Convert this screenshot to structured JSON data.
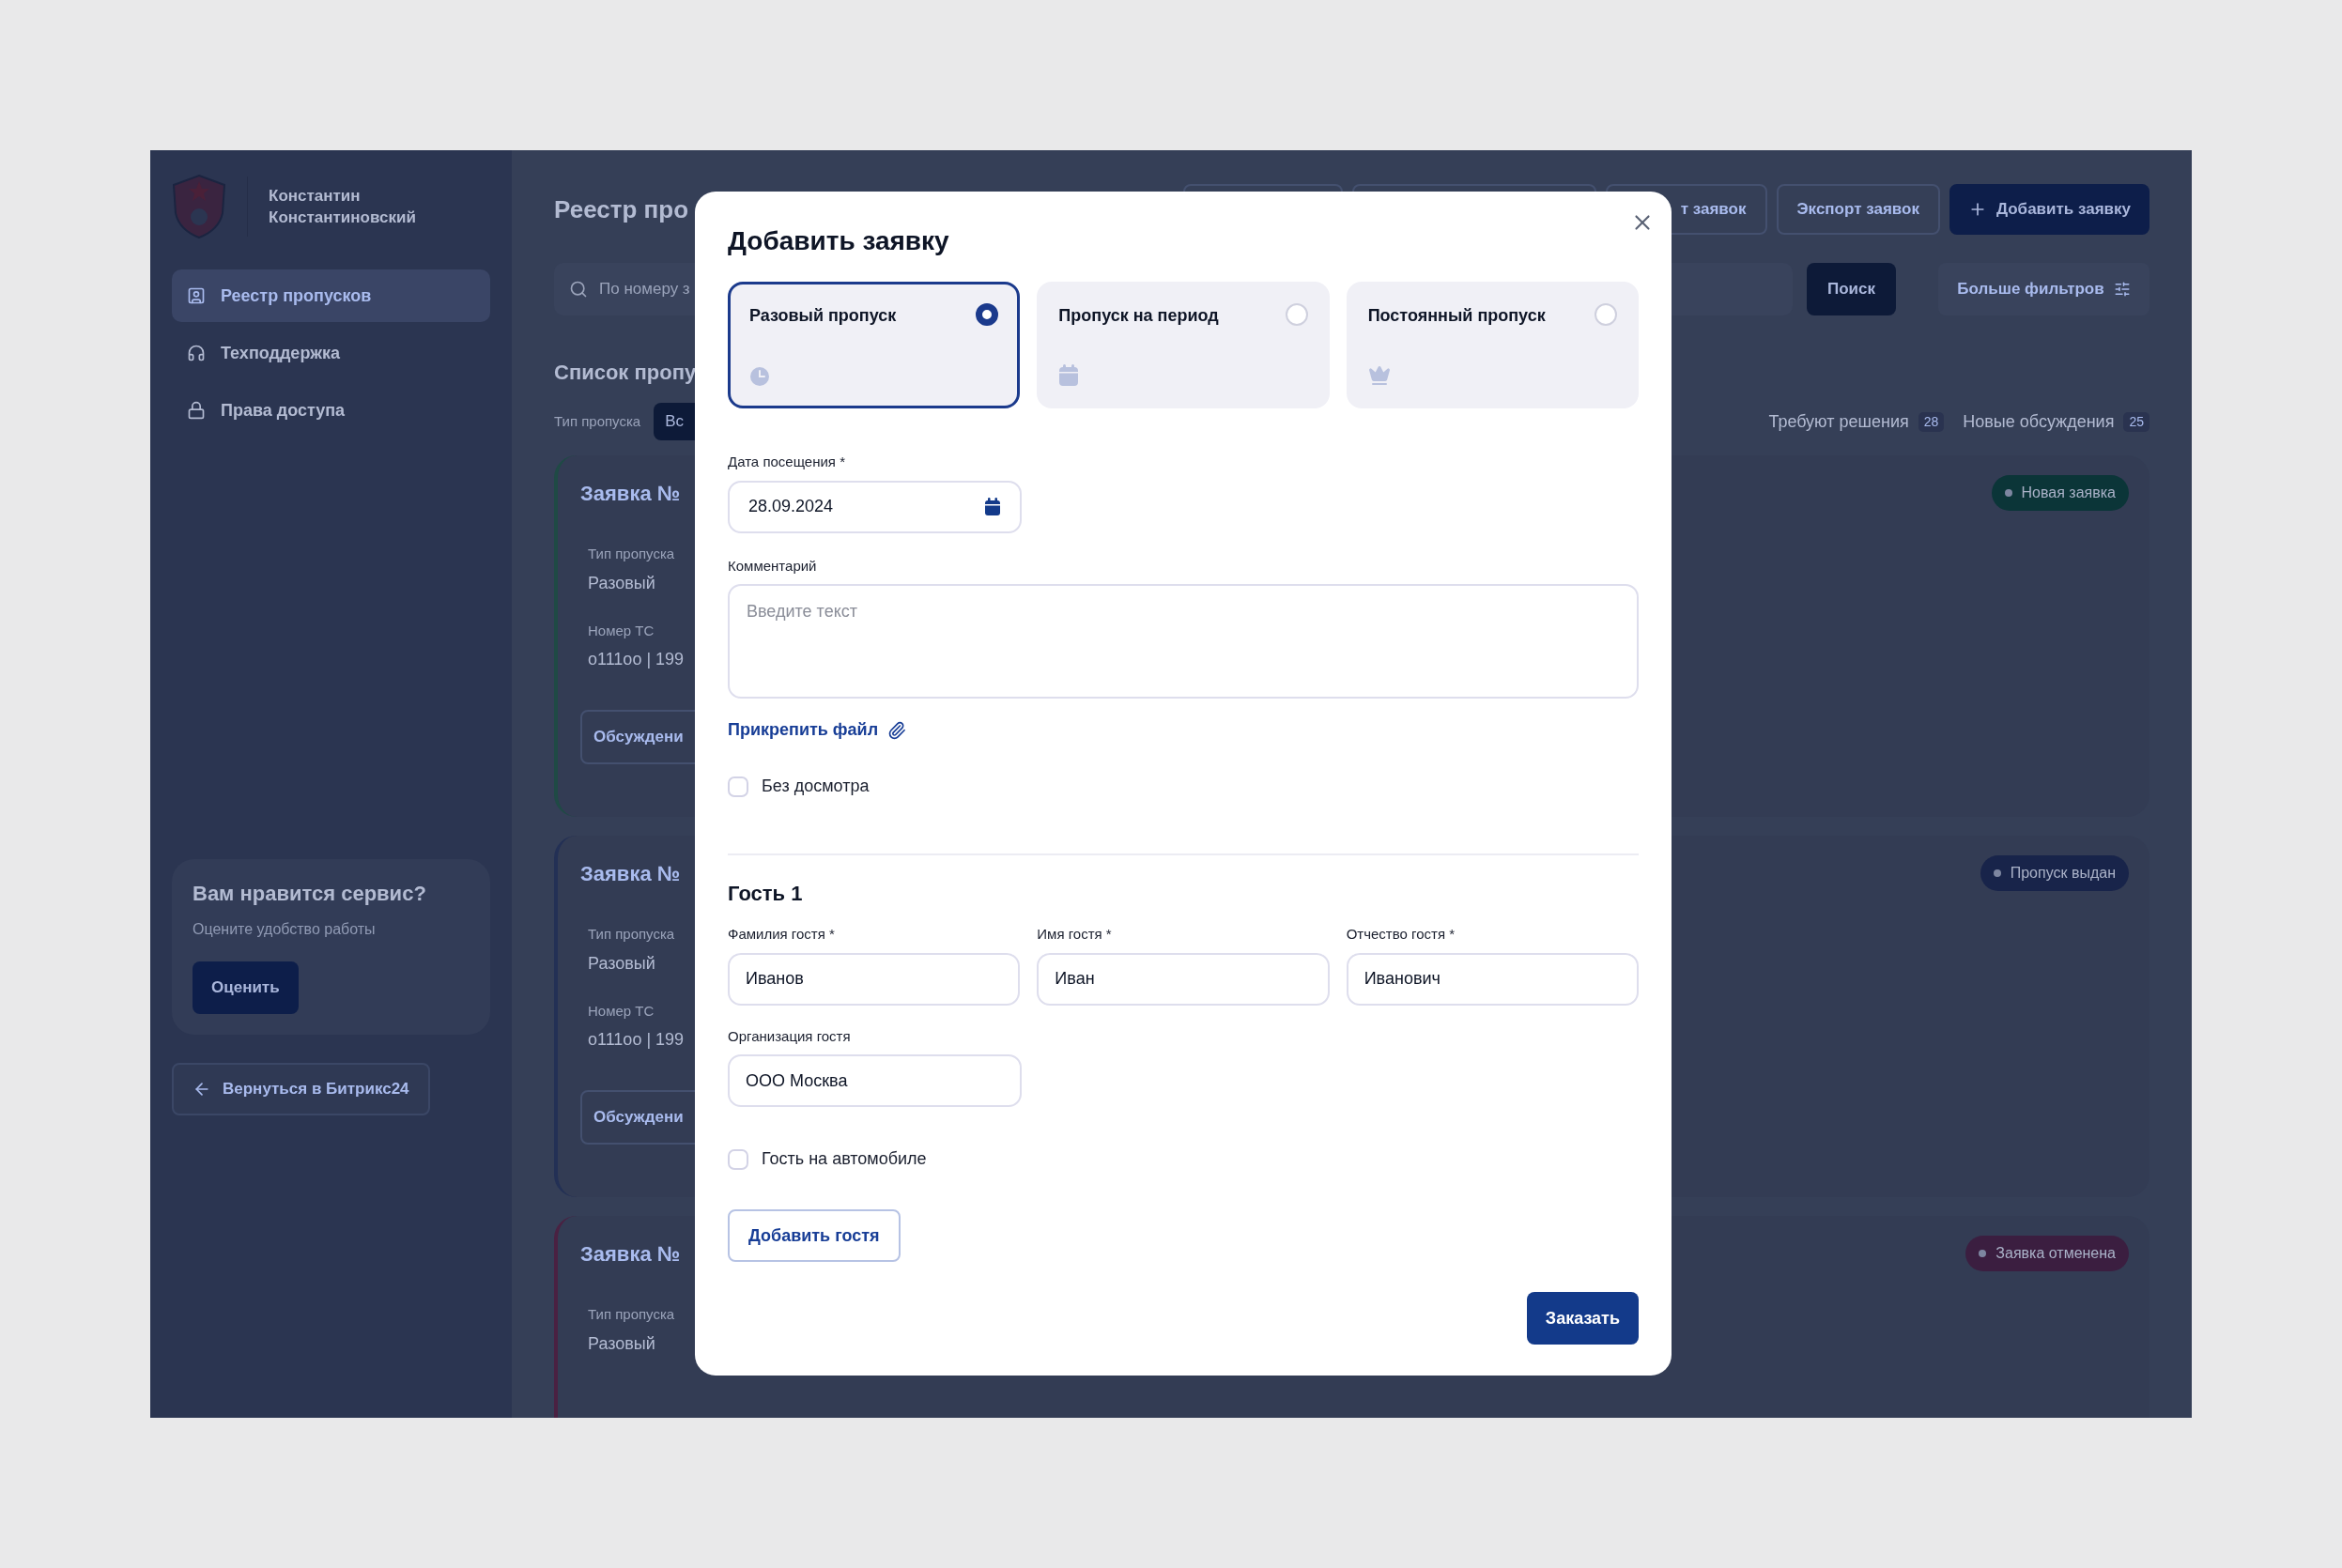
{
  "sidebar": {
    "user_name": "Константин Константиновский",
    "nav": [
      {
        "label": "Реестр пропусков",
        "selected": true
      },
      {
        "label": "Техподдержка",
        "selected": false
      },
      {
        "label": "Права доступа",
        "selected": false
      }
    ],
    "promo": {
      "title": "Вам нравится сервис?",
      "subtitle": "Оцените удобство работы",
      "button": "Оценить"
    },
    "back_button": "Вернуться в Битрикс24"
  },
  "main": {
    "title": "Реестр про",
    "toolbar": [
      {
        "label": "т заявок",
        "kind": "outline"
      },
      {
        "label": "Экспорт заявок",
        "kind": "outline"
      },
      {
        "label": "Добавить заявку",
        "kind": "primary"
      }
    ],
    "search": {
      "placeholder": "По номеру з",
      "button": "Поиск"
    },
    "more_filters": "Больше фильтров",
    "list_title": "Список пропу",
    "filter_label": "Тип пропуска",
    "filter_chip": "Вс",
    "counters": [
      {
        "label": "Требуют решения",
        "count": "28"
      },
      {
        "label": "Новые обсуждения",
        "count": "25"
      }
    ],
    "cards": [
      {
        "title": "Заявка №",
        "color": "#1f4a45",
        "fields": [
          {
            "label": "Тип пропуска",
            "value": "Разовый"
          },
          {
            "label": "Номер ТС",
            "value": "о111оо | 199"
          }
        ],
        "button": "Обсуждени",
        "status": {
          "label": "Новая заявка",
          "color": "#0b3538"
        }
      },
      {
        "title": "Заявка №",
        "color": "#233055",
        "fields": [
          {
            "label": "Тип пропуска",
            "value": "Разовый"
          },
          {
            "label": "Номер ТС",
            "value": "о111оо | 199"
          }
        ],
        "button": "Обсуждени",
        "status": {
          "label": "Пропуск выдан",
          "color": "#18244a"
        }
      },
      {
        "title": "Заявка №",
        "color": "#4a2142",
        "fields": [
          {
            "label": "Тип пропуска",
            "value": "Разовый"
          }
        ],
        "status": {
          "label": "Заявка отменена",
          "color": "#3b1e40"
        }
      }
    ]
  },
  "modal": {
    "title": "Добавить заявку",
    "pass_types": [
      {
        "label": "Разовый пропуск",
        "selected": true
      },
      {
        "label": "Пропуск на период",
        "selected": false
      },
      {
        "label": "Постоянный пропуск",
        "selected": false
      }
    ],
    "date": {
      "label": "Дата посещения *",
      "value": "28.09.2024"
    },
    "comment": {
      "label": "Комментарий",
      "placeholder": "Введите текст"
    },
    "attach_link": "Прикрепить файл",
    "no_inspection": {
      "label": "Без досмотра",
      "checked": false
    },
    "guest": {
      "title": "Гость 1",
      "fields": [
        {
          "label": "Фамилия гостя *",
          "value": "Иванов"
        },
        {
          "label": "Имя гостя *",
          "value": "Иван"
        },
        {
          "label": "Отчество гостя *",
          "value": "Иванович"
        }
      ],
      "organization": {
        "label": "Организация гостя",
        "value": "ООО Москва"
      },
      "car": {
        "label": "Гость на автомобиле",
        "checked": false
      }
    },
    "add_guest_button": "Добавить гостя",
    "submit_button": "Заказать"
  }
}
